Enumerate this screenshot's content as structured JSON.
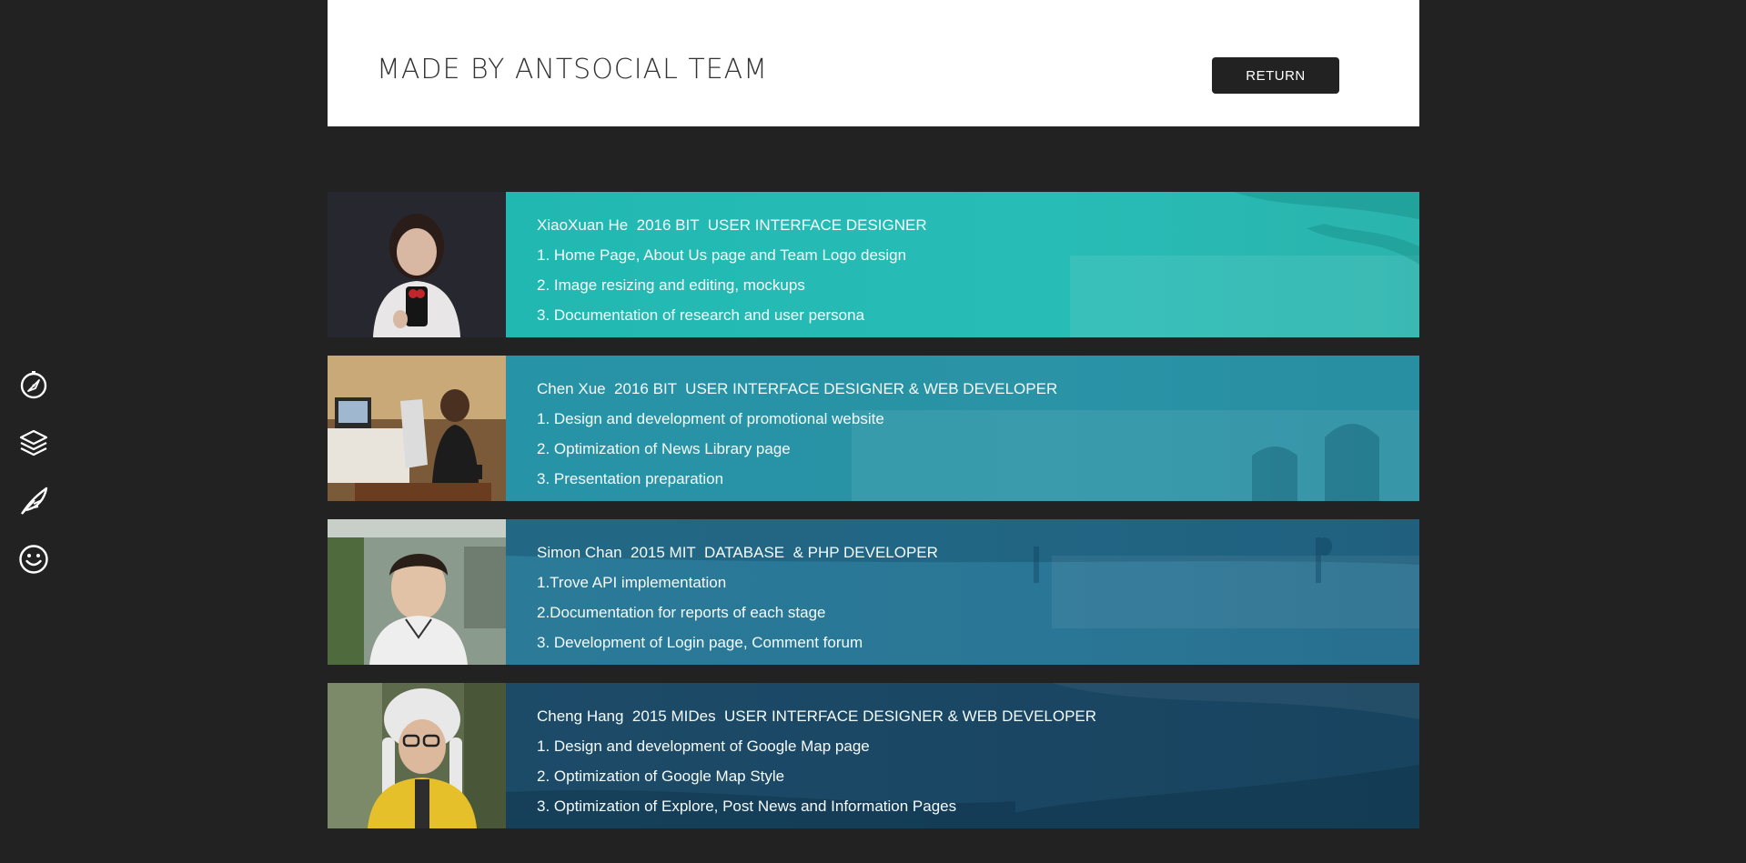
{
  "header": {
    "title": "MADE BY ANTSOCIAL TEAM",
    "return_label": "RETURN"
  },
  "side_nav": [
    {
      "icon": "compass-icon"
    },
    {
      "icon": "layers-icon"
    },
    {
      "icon": "quill-icon"
    },
    {
      "icon": "smiley-icon"
    }
  ],
  "members": [
    {
      "heading": "XiaoXuan He  2016 BIT  USER INTERFACE DESIGNER",
      "lines": [
        "1. Home Page, About Us page and Team Logo design",
        "2. Image resizing and editing, mockups",
        "3. Documentation of research and user persona"
      ]
    },
    {
      "heading": "Chen Xue  2016 BIT  USER INTERFACE DESIGNER & WEB DEVELOPER",
      "lines": [
        "1. Design and development of promotional website",
        "2. Optimization of News Library page",
        "3. Presentation preparation"
      ]
    },
    {
      "heading": "Simon Chan  2015 MIT  DATABASE  & PHP DEVELOPER",
      "lines": [
        "1.Trove API implementation",
        "2.Documentation for reports of each stage",
        "3. Development of Login page, Comment forum"
      ]
    },
    {
      "heading": "Cheng Hang  2015 MIDes  USER INTERFACE DESIGNER & WEB DEVELOPER",
      "lines": [
        "1. Design and development of Google Map page",
        "2. Optimization of Google Map Style",
        "3. Optimization of Explore, Post News and Information Pages"
      ]
    }
  ],
  "colors": {
    "page_background": "#222222",
    "header_background": "#ffffff",
    "button_background": "#222222",
    "card_1": "#22b8b2",
    "card_2": "#2793a7",
    "card_3": "#2b7a98",
    "card_4": "#1c4b68"
  }
}
